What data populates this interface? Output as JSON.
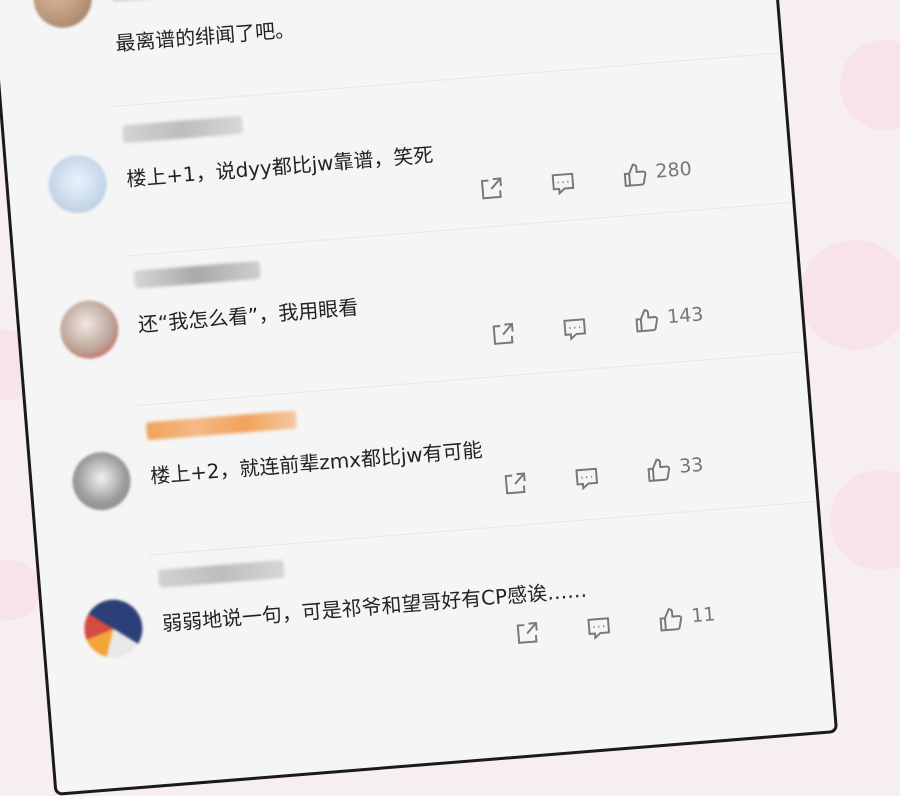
{
  "comments": [
    {
      "text": "最离谱的绯闻了吧。",
      "likes": ""
    },
    {
      "text": "楼上+1，说dyy都比jw靠谱，笑死",
      "likes": "280"
    },
    {
      "text": "还“我怎么看”，我用眼看",
      "likes": "143"
    },
    {
      "text": "楼上+2，就连前辈zmx都比jw有可能",
      "likes": "33"
    },
    {
      "text": "弱弱地说一句，可是祁爷和望哥好有CP感诶……",
      "likes": "11"
    }
  ],
  "icons": {
    "share": "share-icon",
    "reply": "comment-icon",
    "like": "thumbs-up-icon"
  },
  "colors": {
    "username_vip": "#f0a35a",
    "text": "#222222",
    "muted": "#777777"
  }
}
